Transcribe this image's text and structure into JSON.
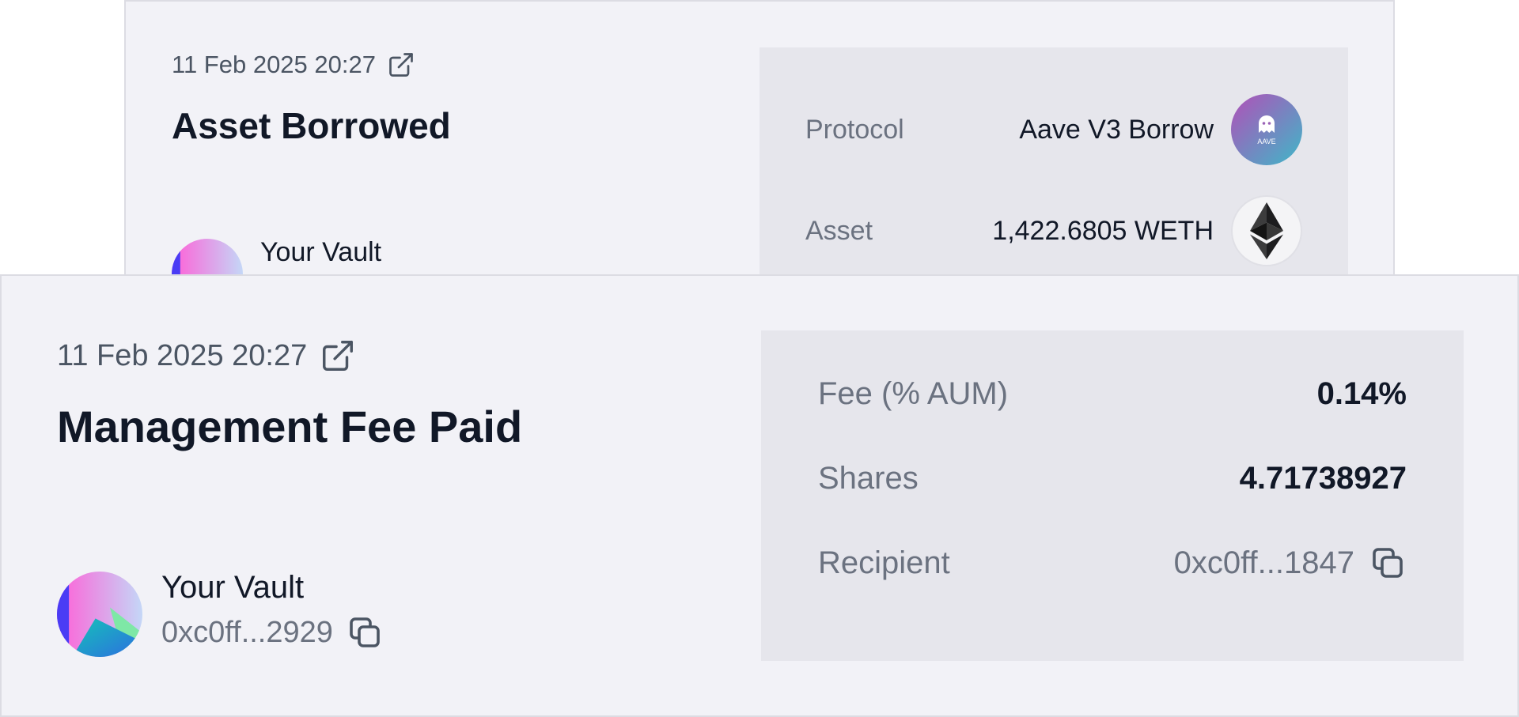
{
  "back_card": {
    "timestamp": "11 Feb 2025 20:27",
    "title": "Asset Borrowed",
    "vault": {
      "name": "Your Vault"
    },
    "details": {
      "protocol_label": "Protocol",
      "protocol_value": "Aave V3 Borrow",
      "protocol_logo_text": "AAVE",
      "asset_label": "Asset",
      "asset_value": "1,422.6805 WETH"
    }
  },
  "front_card": {
    "timestamp": "11 Feb 2025 20:27",
    "title": "Management Fee Paid",
    "vault": {
      "name": "Your Vault",
      "address": "0xc0ff...2929"
    },
    "details": {
      "fee_label": "Fee (% AUM)",
      "fee_value": "0.14%",
      "shares_label": "Shares",
      "shares_value": "4.71738927",
      "recipient_label": "Recipient",
      "recipient_value": "0xc0ff...1847"
    }
  },
  "icons": {
    "external_link": "external-link-icon",
    "copy": "copy-icon",
    "aave": "aave-logo-icon",
    "eth": "ethereum-icon"
  },
  "colors": {
    "card_bg": "#f2f2f7",
    "panel_bg": "#e6e6ec",
    "text_primary": "#111827",
    "text_muted": "#6b7280"
  }
}
